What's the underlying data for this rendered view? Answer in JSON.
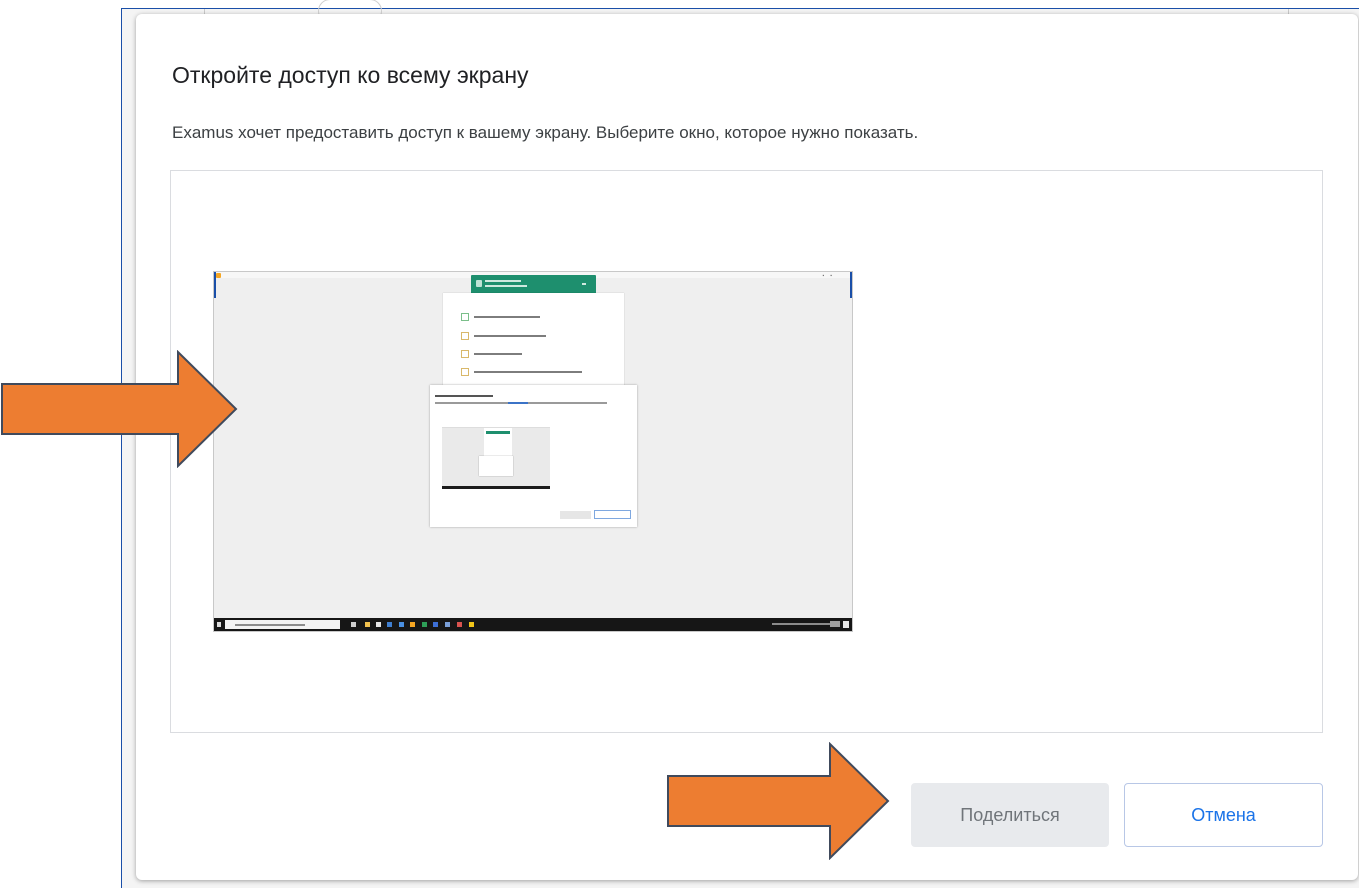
{
  "dialog": {
    "title": "Откройте доступ ко всему экрану",
    "description": "Examus хочет предоставить доступ к вашему экрану. Выберите окно, которое нужно показать.",
    "share_label": "Поделиться",
    "cancel_label": "Отмена",
    "share_enabled": false
  },
  "screen_preview": {
    "selected": true
  },
  "annotations": {
    "arrow_color": "#ed7d31",
    "arrow_border": "#404a5c"
  },
  "colors": {
    "accent": "#1a73e8",
    "disabled_button_bg": "#e8eaed",
    "thumb_accent_green": "#1e8f6e"
  }
}
